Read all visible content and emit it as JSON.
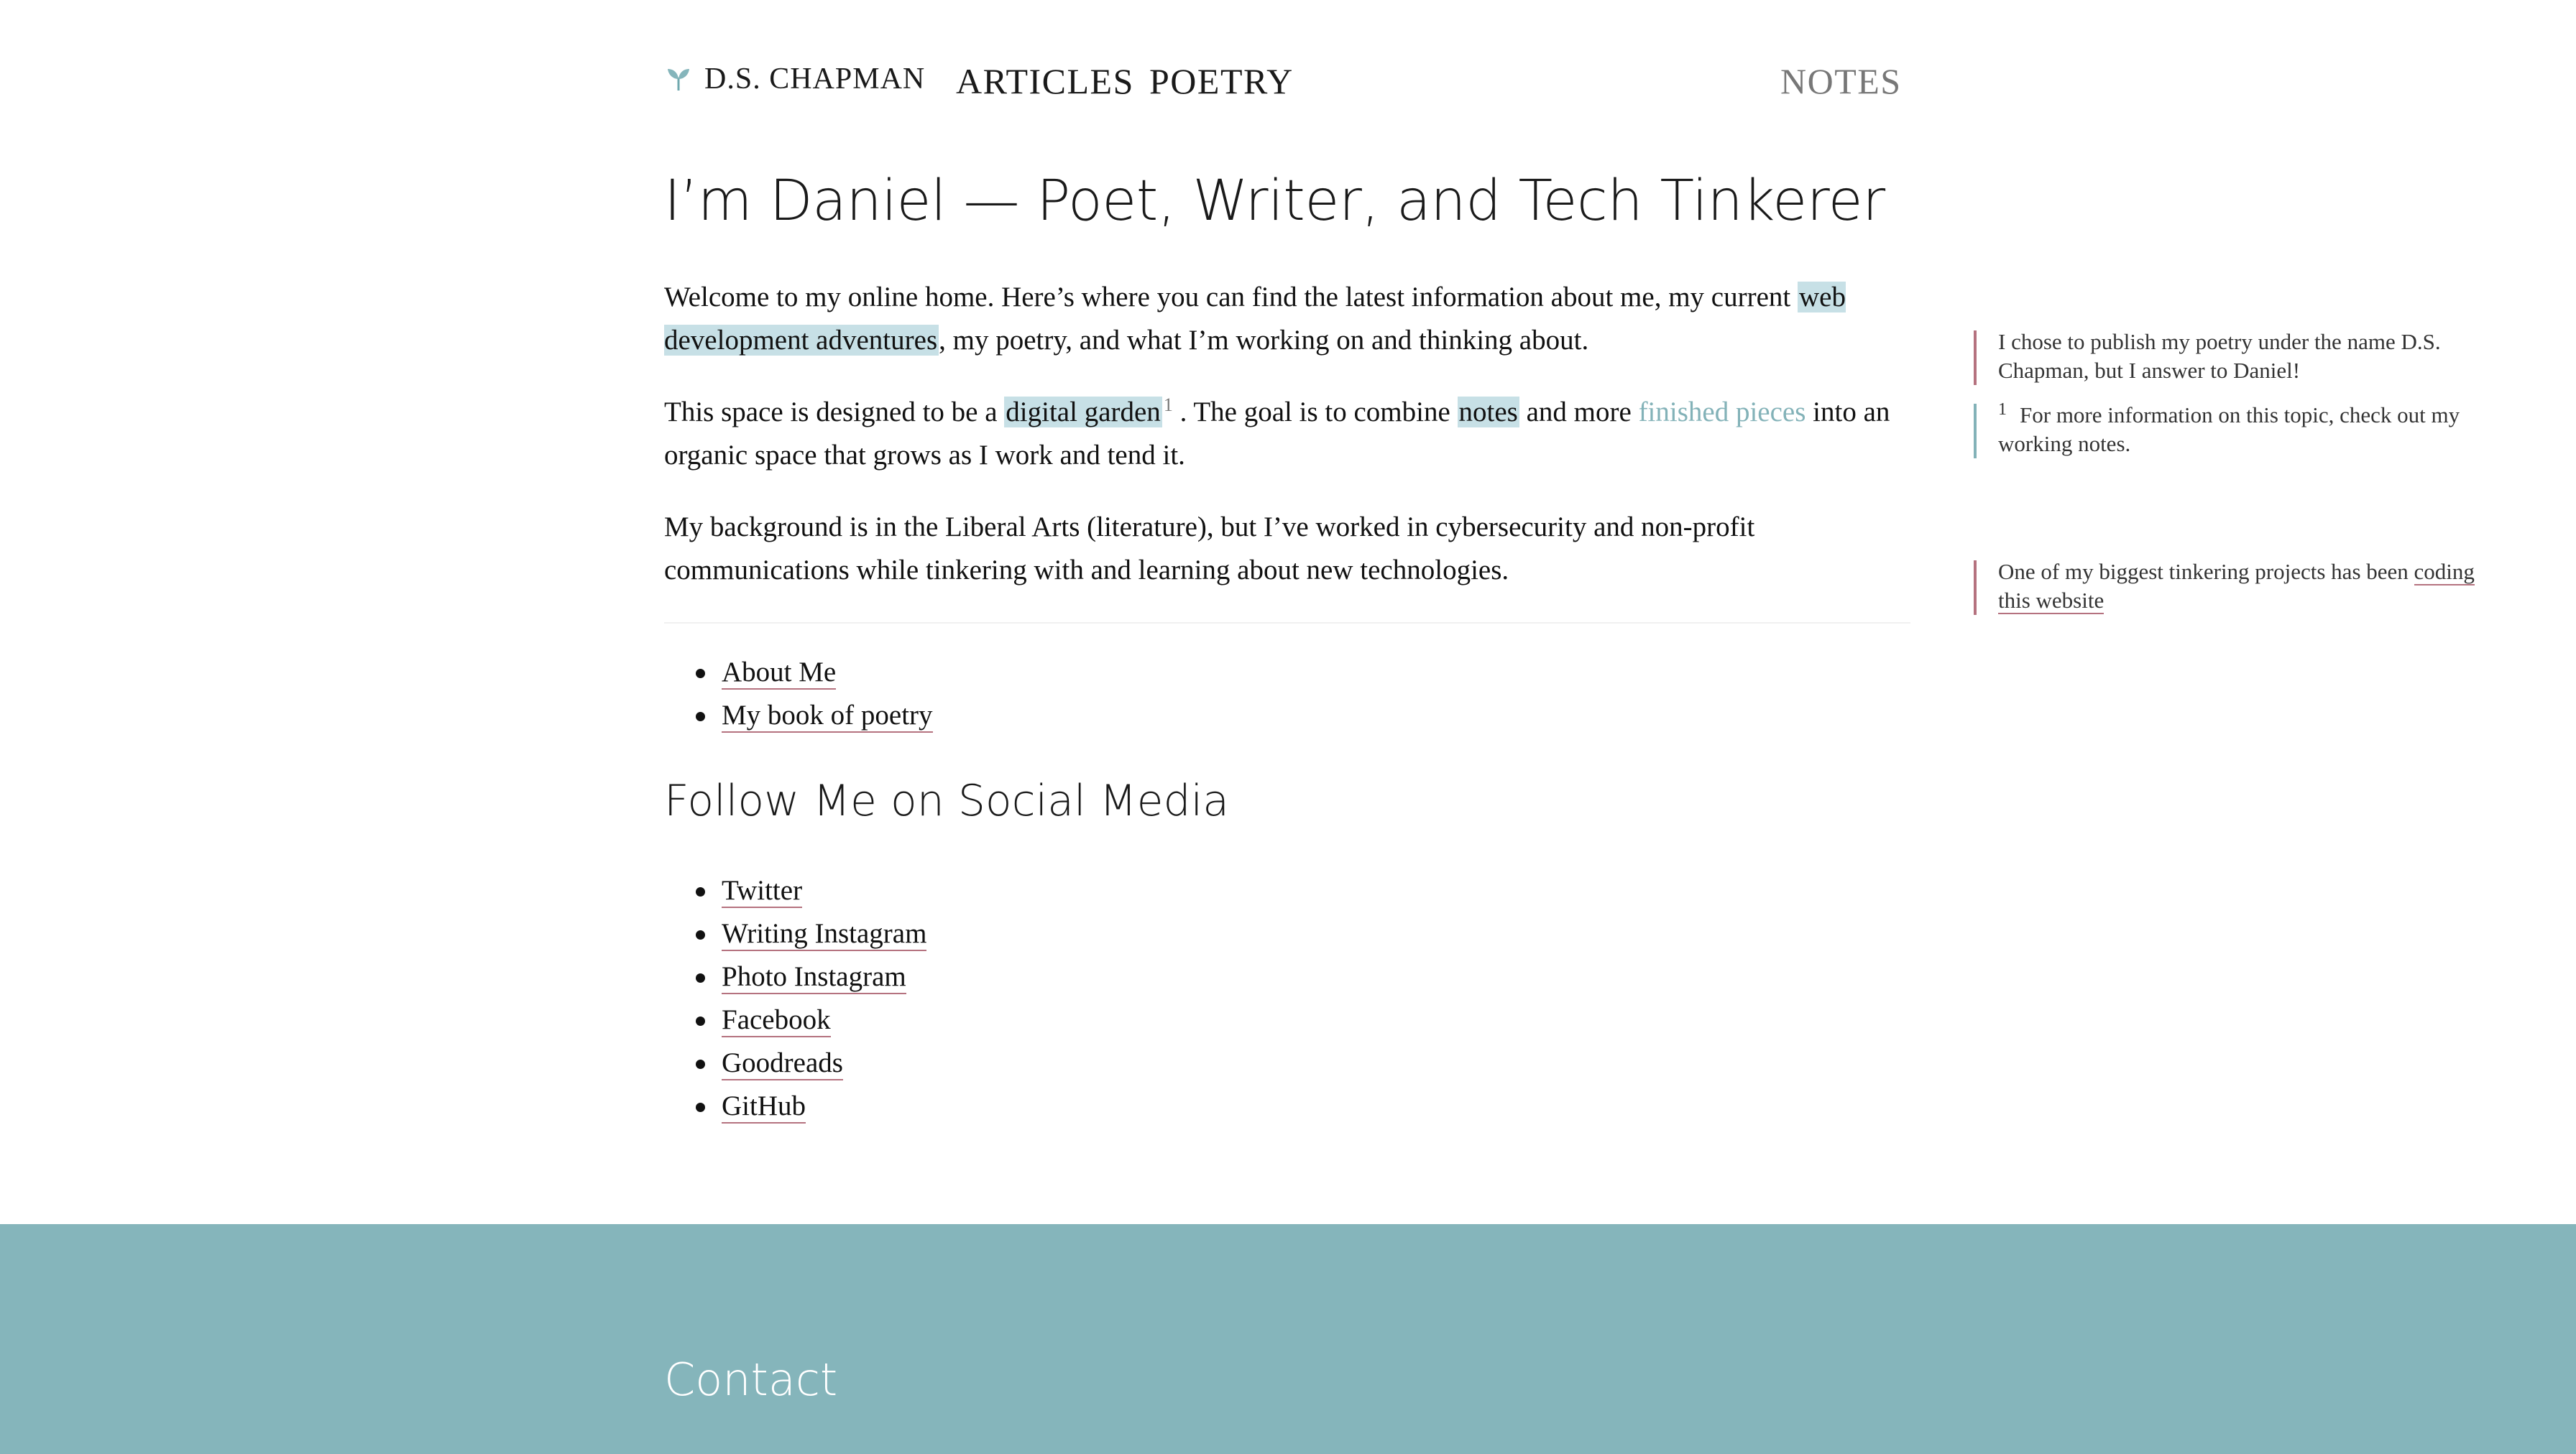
{
  "header": {
    "brand_icon": "sprout-icon",
    "brand_name": "D.S. CHAPMAN",
    "nav": {
      "articles": "ARTICLES",
      "poetry": "POETRY",
      "notes": "NOTES"
    }
  },
  "main": {
    "title": "I’m Daniel — Poet, Writer, and Tech Tinkerer",
    "p1": {
      "a": "Welcome to my online home. Here’s where you can find the latest information about me, my current ",
      "link": "web development adventures",
      "b": ", my poetry, and what I’m working on and thinking about."
    },
    "p2": {
      "a": "This space is designed to be a ",
      "link1": "digital garden",
      "fn": "1",
      "b": " . The goal is to combine ",
      "link2": "notes",
      "c": " and more ",
      "link3": "finished pieces",
      "d": " into an organic space that grows as I work and tend it."
    },
    "p3": "My background is in the Liberal Arts (literature), but I’ve worked in cybersecurity and non-profit communications while tinkering with and learning about new technologies.",
    "links": [
      "About Me",
      "My book of poetry"
    ],
    "social_heading": "Follow Me on Social Media",
    "social_links": [
      "Twitter",
      "Writing Instagram",
      "Photo Instagram",
      "Facebook",
      "Goodreads",
      "GitHub"
    ]
  },
  "sidenotes": {
    "n1": "I chose to publish my poetry under the name D.S. Chapman, but I answer to Daniel!",
    "n2_num": "1",
    "n2": "For more information on this topic, check out my working notes.",
    "n3_text": "One of my biggest tinkering projects has been ",
    "n3_link": "coding this website"
  },
  "footer": {
    "heading": "Contact"
  },
  "colors": {
    "accent_teal": "#85b5bb",
    "highlight": "#c7e0e6",
    "link_underline": "#b5727f"
  }
}
